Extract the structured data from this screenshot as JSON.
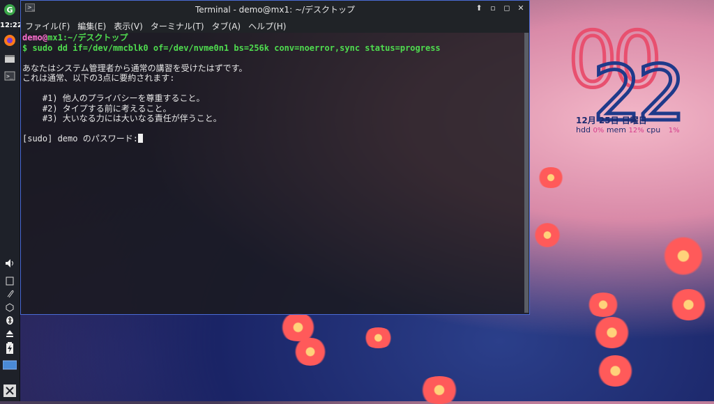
{
  "panel": {
    "clock": "12:22",
    "icons": [
      "mx-logo-icon",
      "firefox-icon",
      "file-manager-icon",
      "terminal-icon",
      "volume-icon",
      "clipboard-icon",
      "attachment-icon",
      "network-icon",
      "bluetooth-icon",
      "eject-icon",
      "battery-icon",
      "workspace-icon",
      "exit-icon"
    ]
  },
  "terminal": {
    "title": "Terminal - demo@mx1: ~/デスクトップ",
    "window_buttons": {
      "up": "⬆",
      "minimize": "▫",
      "maximize": "◻",
      "close": "✕"
    },
    "menu": [
      "ファイル(F)",
      "編集(E)",
      "表示(V)",
      "ターミナル(T)",
      "タブ(A)",
      "ヘルプ(H)"
    ],
    "prompt_user": "demo",
    "prompt_at": "@",
    "prompt_host": "mx1",
    "prompt_path": ":~/デスクトップ",
    "command": "$ sudo dd if=/dev/mmcblk0 of=/dev/nvme0n1 bs=256k conv=noerror,sync status=progress",
    "lecture_1": "あなたはシステム管理者から通常の講習を受けたはずです。",
    "lecture_2": "これは通常、以下の3点に要約されます:",
    "rule_1": "    #1) 他人のプライバシーを尊重すること。",
    "rule_2": "    #2) タイプする前に考えること。",
    "rule_3": "    #3) 大いなる力には大いなる責任が伴うこと。",
    "password_prompt": "[sudo] demo のパスワード:"
  },
  "conky": {
    "hours": "00",
    "minutes": "22",
    "date": "12月 25日 日曜日",
    "hdd_label": "hdd",
    "hdd_value": "0%",
    "mem_label": "mem",
    "mem_value": "12%",
    "cpu_label": "cpu",
    "cpu_value": "1%"
  },
  "colors": {
    "accent": "#4a6bd6",
    "prompt": "#4fdc4f",
    "hostname": "#ff6fd0",
    "clock_hours": "#e8506f",
    "clock_minutes": "#1f3a8a"
  }
}
